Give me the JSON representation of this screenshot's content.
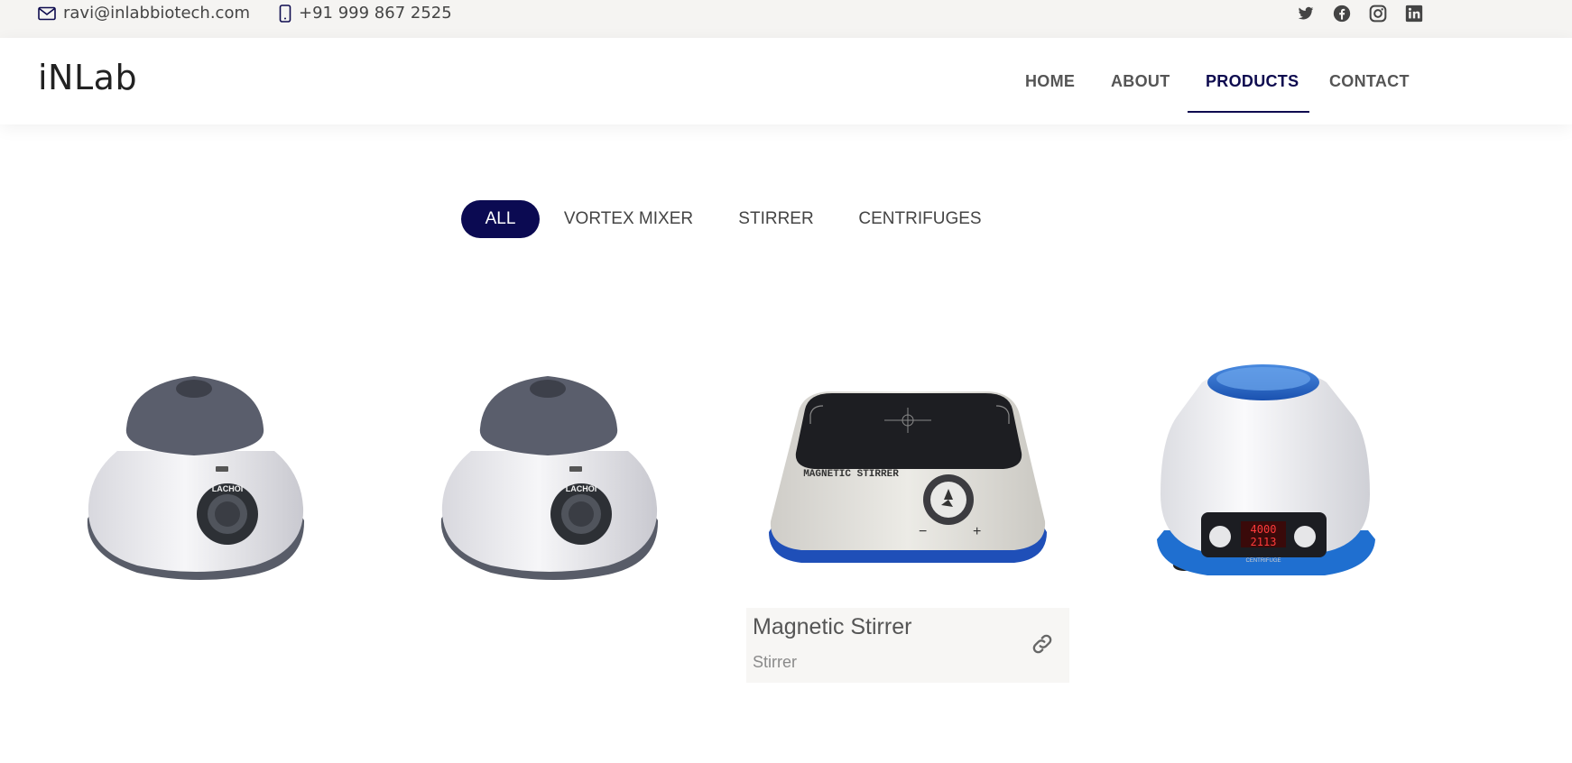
{
  "topbar": {
    "email": "ravi@inlabbiotech.com",
    "phone": "+91 999 867 2525",
    "icons": {
      "email": "envelope-icon",
      "phone": "mobile-phone-icon"
    },
    "social": [
      {
        "name": "twitter-icon"
      },
      {
        "name": "facebook-icon"
      },
      {
        "name": "instagram-icon"
      },
      {
        "name": "linkedin-icon"
      }
    ]
  },
  "header": {
    "logo": "iNLab",
    "nav": [
      {
        "label": "HOME",
        "active": false
      },
      {
        "label": "ABOUT",
        "active": false
      },
      {
        "label": "PRODUCTS",
        "active": true
      },
      {
        "label": "CONTACT",
        "active": false
      }
    ]
  },
  "filters": [
    {
      "label": "ALL",
      "active": true
    },
    {
      "label": "VORTEX MIXER",
      "active": false
    },
    {
      "label": "STIRRER",
      "active": false
    },
    {
      "label": "CENTRIFUGES",
      "active": false
    }
  ],
  "products": [
    {
      "type": "vortex-mixer",
      "brand_text": "LACHOI"
    },
    {
      "type": "vortex-mixer",
      "brand_text": "LACHOI"
    },
    {
      "type": "magnetic-stirrer",
      "device_text": "MAGNETIC STIRRER"
    },
    {
      "type": "centrifuge",
      "display_top": "4000",
      "display_bottom": "2113",
      "device_text": "CENTRIFUGE"
    }
  ],
  "hover_card": {
    "title": "Magnetic Stirrer",
    "category": "Stirrer",
    "link_icon": "link-icon"
  },
  "colors": {
    "accent": "#0b0a52",
    "topbar_bg": "#f5f4f2",
    "text": "#444444",
    "card_bg": "#f7f6f4"
  }
}
